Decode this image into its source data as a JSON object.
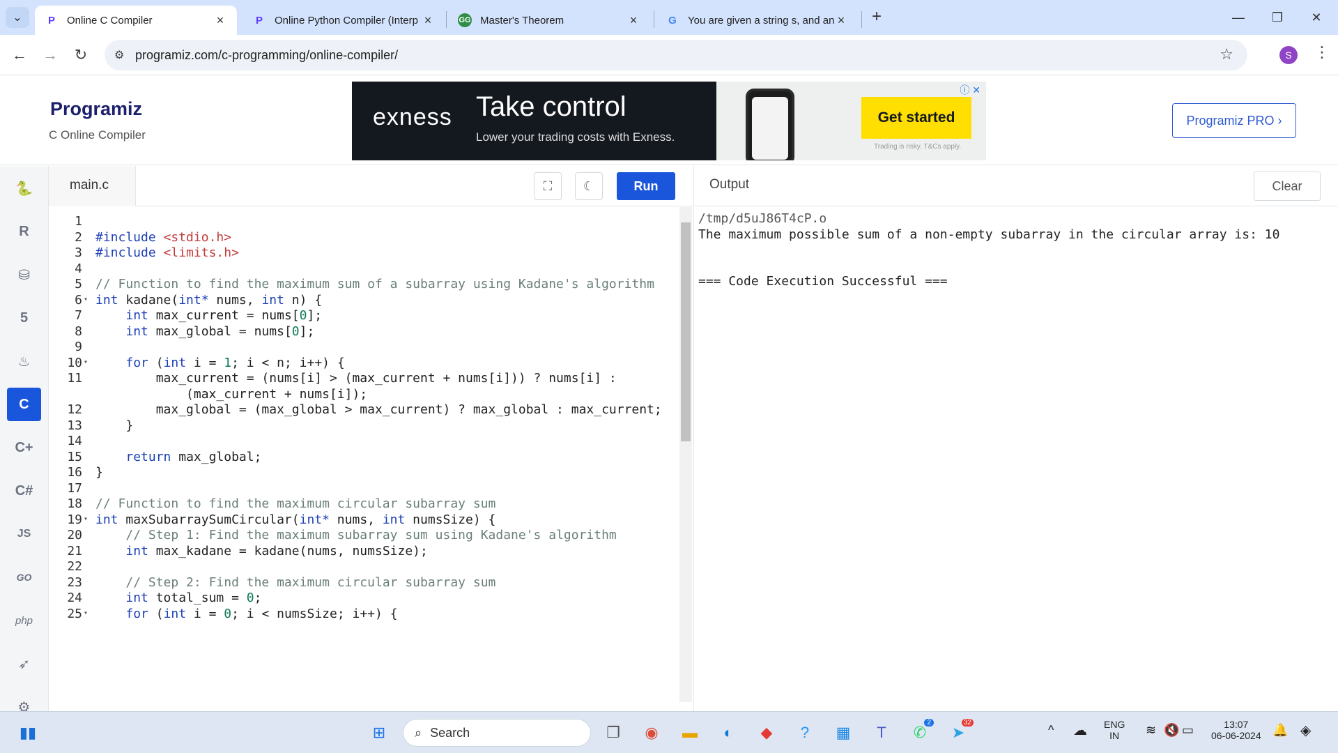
{
  "browser": {
    "tabs": [
      {
        "title": "Online C Compiler",
        "favicon": "programiz-icon",
        "active": true
      },
      {
        "title": "Online Python Compiler (Interp",
        "favicon": "programiz-icon",
        "active": false
      },
      {
        "title": "Master's Theorem",
        "favicon": "geeksforgeeks-icon",
        "active": false
      },
      {
        "title": "You are given a string s, and an",
        "favicon": "google-icon",
        "active": false
      }
    ],
    "url": "programiz.com/c-programming/online-compiler/",
    "profile_initial": "S"
  },
  "site": {
    "logo": "Programiz",
    "subtitle": "C Online Compiler",
    "pro_button": "Programiz PRO ›"
  },
  "ad": {
    "brand": "exness",
    "headline": "Take control",
    "tagline": "Lower your trading costs with Exness.",
    "cta": "Get started",
    "fine_print": "Trading is risky. T&Cs apply."
  },
  "editor": {
    "filename": "main.c",
    "run_label": "Run",
    "lines": [
      {
        "n": "1",
        "fold": false,
        "html": ""
      },
      {
        "n": "2",
        "fold": false,
        "html": "<span class='kw'>#include</span> <span class='inc'>&lt;stdio.h&gt;</span>"
      },
      {
        "n": "3",
        "fold": false,
        "html": "<span class='kw'>#include</span> <span class='inc'>&lt;limits.h&gt;</span>"
      },
      {
        "n": "4",
        "fold": false,
        "html": ""
      },
      {
        "n": "5",
        "fold": false,
        "html": "<span class='cm'>// Function to find the maximum sum of a subarray using Kadane's algorithm</span>"
      },
      {
        "n": "6",
        "fold": true,
        "html": "<span class='kw'>int</span> kadane(<span class='kw'>int*</span> nums, <span class='kw'>int</span> n) {"
      },
      {
        "n": "7",
        "fold": false,
        "html": "    <span class='kw'>int</span> max_current = nums[<span class='num'>0</span>];"
      },
      {
        "n": "8",
        "fold": false,
        "html": "    <span class='kw'>int</span> max_global = nums[<span class='num'>0</span>];"
      },
      {
        "n": "9",
        "fold": false,
        "html": ""
      },
      {
        "n": "10",
        "fold": true,
        "html": "    <span class='kw'>for</span> (<span class='kw'>int</span> i = <span class='num'>1</span>; i &lt; n; i++) {"
      },
      {
        "n": "11",
        "fold": false,
        "html": "        max_current = (nums[i] &gt; (max_current + nums[i])) ? nums[i] :"
      },
      {
        "n": "",
        "fold": false,
        "html": "            (max_current + nums[i]);"
      },
      {
        "n": "12",
        "fold": false,
        "html": "        max_global = (max_global &gt; max_current) ? max_global : max_current;"
      },
      {
        "n": "13",
        "fold": false,
        "html": "    }"
      },
      {
        "n": "14",
        "fold": false,
        "html": ""
      },
      {
        "n": "15",
        "fold": false,
        "html": "    <span class='kw'>return</span> max_global;"
      },
      {
        "n": "16",
        "fold": false,
        "html": "}"
      },
      {
        "n": "17",
        "fold": false,
        "html": ""
      },
      {
        "n": "18",
        "fold": false,
        "html": "<span class='cm'>// Function to find the maximum circular subarray sum</span>"
      },
      {
        "n": "19",
        "fold": true,
        "html": "<span class='kw'>int</span> maxSubarraySumCircular(<span class='kw'>int*</span> nums, <span class='kw'>int</span> numsSize) {"
      },
      {
        "n": "20",
        "fold": false,
        "html": "    <span class='cm'>// Step 1: Find the maximum subarray sum using Kadane's algorithm</span>"
      },
      {
        "n": "21",
        "fold": false,
        "html": "    <span class='kw'>int</span> max_kadane = kadane(nums, numsSize);"
      },
      {
        "n": "22",
        "fold": false,
        "html": ""
      },
      {
        "n": "23",
        "fold": false,
        "html": "    <span class='cm'>// Step 2: Find the maximum circular subarray sum</span>"
      },
      {
        "n": "24",
        "fold": false,
        "html": "    <span class='kw'>int</span> total_sum = <span class='num'>0</span>;"
      },
      {
        "n": "25",
        "fold": true,
        "html": "    <span class='kw'>for</span> (<span class='kw'>int</span> i = <span class='num'>0</span>; i &lt; numsSize; i++) {"
      }
    ]
  },
  "output": {
    "label": "Output",
    "clear_label": "Clear",
    "lines": [
      "/tmp/d5uJ86T4cP.o",
      "The maximum possible sum of a non-empty subarray in the circular array is: 10",
      "",
      "",
      "=== Code Execution Successful ==="
    ]
  },
  "rail": [
    "python-icon",
    "r-icon",
    "sql-icon",
    "html-icon",
    "java-icon",
    "c-icon",
    "cpp-icon",
    "csharp-icon",
    "js-icon",
    "go-icon",
    "php-icon",
    "swift-icon",
    "rust-icon"
  ],
  "taskbar": {
    "search_placeholder": "Search",
    "lang": "ENG",
    "region": "IN",
    "time": "13:07",
    "date": "06-06-2024",
    "whatsapp_badge": "2",
    "telegram_badge": "32"
  }
}
